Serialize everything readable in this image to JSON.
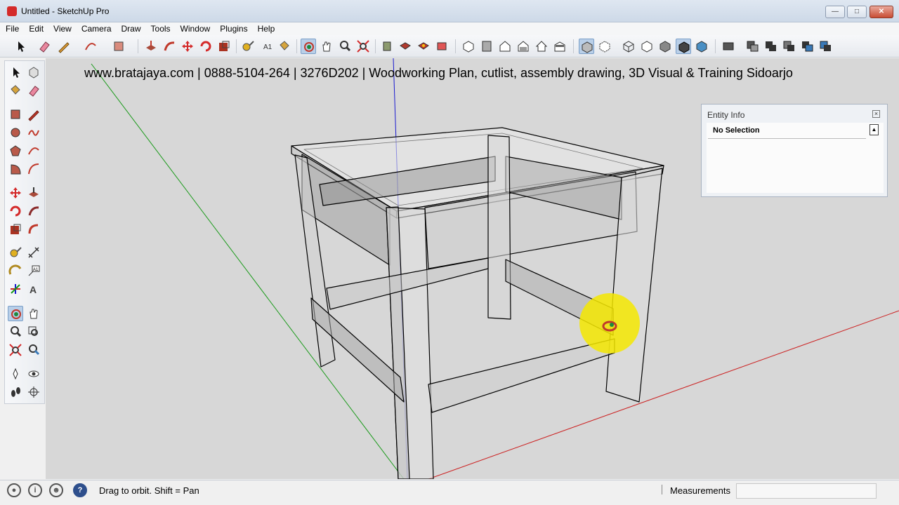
{
  "window": {
    "title": "Untitled - SketchUp Pro",
    "controls": [
      "minimize",
      "maximize",
      "close"
    ]
  },
  "menu": [
    "File",
    "Edit",
    "View",
    "Camera",
    "Draw",
    "Tools",
    "Window",
    "Plugins",
    "Help"
  ],
  "toolbar": {
    "tools": [
      "select",
      "eraser",
      "pencil",
      "arc",
      "rectangle",
      "push-pull",
      "follow-me",
      "move",
      "rotate",
      "scale",
      "tape-measure",
      "text",
      "paint-bucket",
      "orbit",
      "pan",
      "zoom",
      "zoom-extents",
      "components",
      "materials",
      "styles",
      "section",
      "iso-view",
      "top-view",
      "front-view",
      "right-view",
      "back-view",
      "left-view",
      "xray",
      "back-edges",
      "wireframe",
      "hidden-line",
      "shaded",
      "shaded-textures",
      "monochrome",
      "solid-union",
      "solid-subtract",
      "solid-trim",
      "solid-intersect",
      "solid-split"
    ],
    "active_tool": "orbit"
  },
  "left_toolbar": {
    "active_tool": "orbit"
  },
  "viewport": {
    "watermark": "www.bratajaya.com | 0888-5104-264 | 3276D202 | Woodworking Plan, cutlist, assembly drawing, 3D Visual & Training Sidoarjo",
    "axis_colors": {
      "red": "#cc2222",
      "green": "#1a9a1a",
      "blue": "#1a1ad0"
    },
    "background": "#d7d7d7"
  },
  "entity_info": {
    "title": "Entity Info",
    "selection": "No Selection"
  },
  "status": {
    "message": "Drag to orbit.  Shift = Pan",
    "measurements_label": "Measurements",
    "measurements_value": ""
  }
}
